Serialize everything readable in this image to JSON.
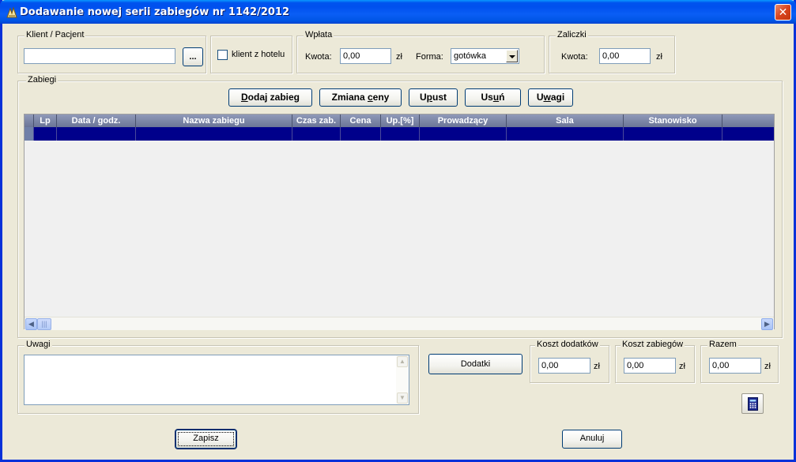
{
  "window": {
    "title": "Dodawanie nowej serii zabiegów nr 1142/2012"
  },
  "client": {
    "legend": "Klient / Pacjent",
    "value": "",
    "browse_label": "..."
  },
  "hotel": {
    "checkbox_label": "klient z hotelu",
    "checked": false
  },
  "payment": {
    "legend": "Wpłata",
    "amount_label": "Kwota:",
    "amount_value": "0,00",
    "currency": "zł",
    "form_label": "Forma:",
    "form_value": "gotówka"
  },
  "advances": {
    "legend": "Zaliczki",
    "amount_label": "Kwota:",
    "amount_value": "0,00",
    "currency": "zł"
  },
  "treatments": {
    "legend": "Zabiegi",
    "buttons": [
      {
        "pre": "",
        "ul": "D",
        "post": "odaj zabieg"
      },
      {
        "pre": "Zmiana ",
        "ul": "c",
        "post": "eny"
      },
      {
        "pre": "U",
        "ul": "p",
        "post": "ust"
      },
      {
        "pre": "Us",
        "ul": "u",
        "post": "ń"
      },
      {
        "pre": "U",
        "ul": "w",
        "post": "agi"
      }
    ],
    "columns": [
      "Lp",
      "Data / godz.",
      "Nazwa zabiegu",
      "Czas zab.",
      "Cena",
      "Up.[%]",
      "Prowadzący",
      "Sala",
      "Stanowisko"
    ]
  },
  "notes": {
    "legend": "Uwagi",
    "value": ""
  },
  "extras_button": "Dodatki",
  "totals": {
    "extras": {
      "legend": "Koszt dodatków",
      "value": "0,00",
      "currency": "zł"
    },
    "treatments": {
      "legend": "Koszt zabiegów",
      "value": "0,00",
      "currency": "zł"
    },
    "sum": {
      "legend": "Razem",
      "value": "0,00",
      "currency": "zł"
    }
  },
  "footer": {
    "save_label": "Zapisz",
    "cancel_label": "Anuluj"
  },
  "icons": {
    "title": "app-icon",
    "calculator": "calculator-icon",
    "close": "close-icon"
  }
}
